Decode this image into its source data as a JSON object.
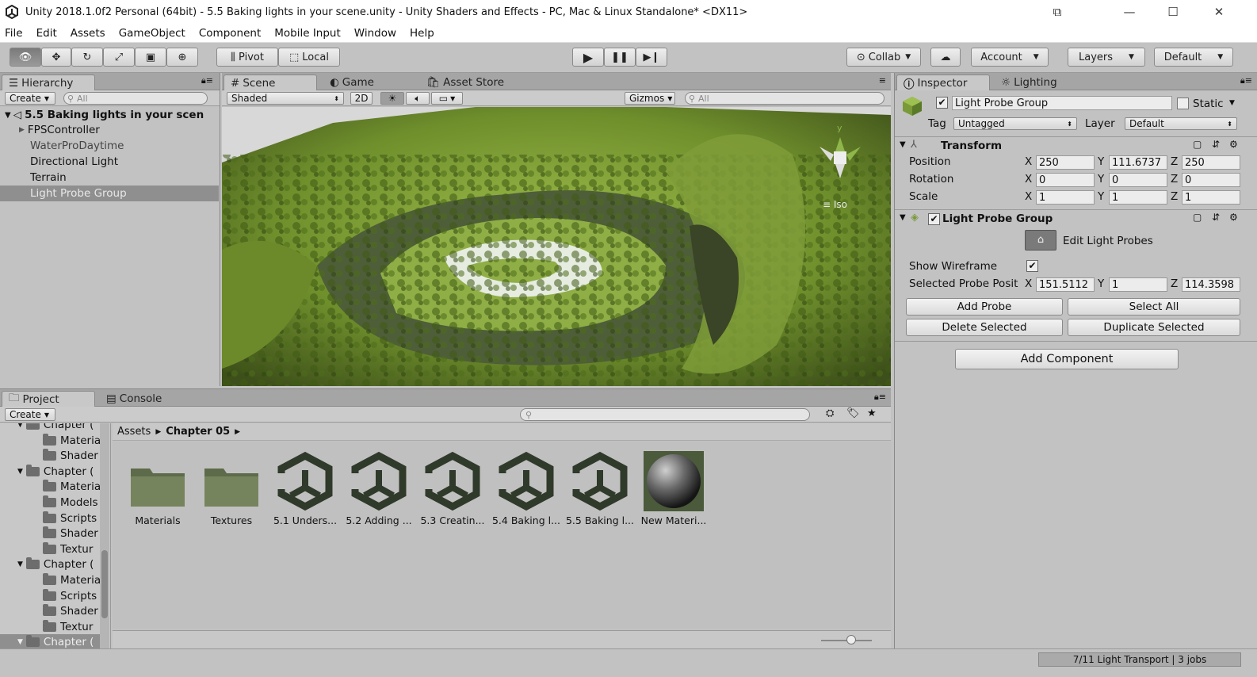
{
  "window": {
    "title": "Unity 2018.1.0f2 Personal (64bit) - 5.5 Baking lights in your scene.unity - Unity Shaders and Effects - PC, Mac & Linux Standalone* <DX11>",
    "minimize": "—",
    "maximize": "☐",
    "close": "✕"
  },
  "menu": [
    "File",
    "Edit",
    "Assets",
    "GameObject",
    "Component",
    "Mobile Input",
    "Window",
    "Help"
  ],
  "toolbar": {
    "pivot": "Pivot",
    "local": "Local",
    "collab": "Collab",
    "account": "Account",
    "layers": "Layers",
    "layout": "Default"
  },
  "hierarchy": {
    "tab": "Hierarchy",
    "create": "Create",
    "search_placeholder": "All",
    "scene": "5.5 Baking lights in your scen",
    "items": [
      "FPSController",
      "WaterProDaytime",
      "Directional Light",
      "Terrain",
      "Light Probe Group"
    ]
  },
  "scene": {
    "tabs": [
      "Scene",
      "Game",
      "Asset Store"
    ],
    "shading": "Shaded",
    "mode2d": "2D",
    "gizmos": "Gizmos",
    "search_placeholder": "All",
    "projection": "Iso",
    "gizmo_axis": "y"
  },
  "inspector": {
    "tabs": [
      "Inspector",
      "Lighting"
    ],
    "object_name": "Light Probe Group",
    "static_label": "Static",
    "tag_label": "Tag",
    "tag_value": "Untagged",
    "layer_label": "Layer",
    "layer_value": "Default",
    "transform": {
      "title": "Transform",
      "position_label": "Position",
      "rotation_label": "Rotation",
      "scale_label": "Scale",
      "position": [
        "250",
        "111.6737",
        "250"
      ],
      "rotation": [
        "0",
        "0",
        "0"
      ],
      "scale": [
        "1",
        "1",
        "1"
      ]
    },
    "probe": {
      "title": "Light Probe Group",
      "edit": "Edit Light Probes",
      "show_wireframe": "Show Wireframe",
      "selected_probe": "Selected Probe Posit",
      "selected": [
        "151.5112",
        "1",
        "114.3598"
      ],
      "add_probe": "Add Probe",
      "select_all": "Select All",
      "delete_selected": "Delete Selected",
      "duplicate_selected": "Duplicate Selected"
    },
    "add_component": "Add Component",
    "axes": [
      "X",
      "Y",
      "Z"
    ]
  },
  "project": {
    "tabs": [
      "Project",
      "Console"
    ],
    "create": "Create",
    "breadcrumb": [
      "Assets",
      "Chapter 05"
    ],
    "tree": [
      {
        "label": "Chapter (",
        "level": 0,
        "open": true
      },
      {
        "label": "Materia",
        "level": 1
      },
      {
        "label": "Shader",
        "level": 1
      },
      {
        "label": "Chapter (",
        "level": 0,
        "open": true
      },
      {
        "label": "Materia",
        "level": 1
      },
      {
        "label": "Models",
        "level": 1
      },
      {
        "label": "Scripts",
        "level": 1
      },
      {
        "label": "Shader",
        "level": 1
      },
      {
        "label": "Textur",
        "level": 1
      },
      {
        "label": "Chapter (",
        "level": 0,
        "open": true
      },
      {
        "label": "Materia",
        "level": 1
      },
      {
        "label": "Scripts",
        "level": 1
      },
      {
        "label": "Shader",
        "level": 1
      },
      {
        "label": "Textur",
        "level": 1
      },
      {
        "label": "Chapter (",
        "level": 0,
        "open": true
      }
    ],
    "assets": [
      "Materials",
      "Textures",
      "5.1 Unders...",
      "5.2 Adding ...",
      "5.3 Creatin...",
      "5.4 Baking l...",
      "5.5 Baking l...",
      "New Materi..."
    ]
  },
  "status": "7/11 Light Transport | 3 jobs"
}
